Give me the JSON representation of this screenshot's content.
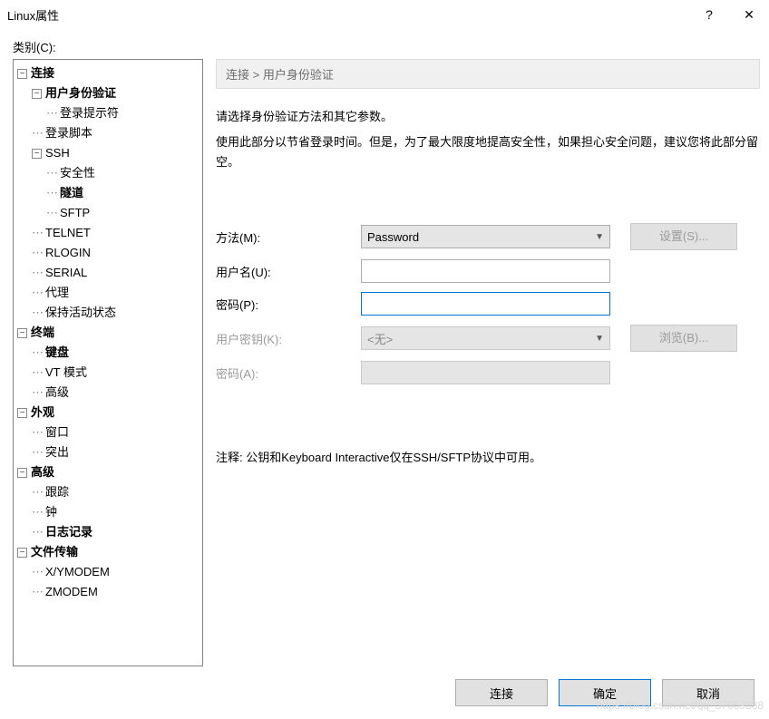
{
  "window": {
    "title": "Linux属性",
    "help": "?",
    "close": "✕"
  },
  "category_label": "类别(C):",
  "tree": {
    "connection": "连接",
    "user_auth": "用户身份验证",
    "login_prompt": "登录提示符",
    "login_script": "登录脚本",
    "ssh": "SSH",
    "security": "安全性",
    "tunnel": "隧道",
    "sftp": "SFTP",
    "telnet": "TELNET",
    "rlogin": "RLOGIN",
    "serial": "SERIAL",
    "proxy": "代理",
    "keep_alive": "保持活动状态",
    "terminal": "终端",
    "keyboard": "键盘",
    "vt_mode": "VT 模式",
    "advanced_term": "高级",
    "appearance": "外观",
    "window": "窗口",
    "highlight": "突出",
    "advanced": "高级",
    "tracking": "跟踪",
    "bell": "钟",
    "logging": "日志记录",
    "file_transfer": "文件传输",
    "xymodem": "X/YMODEM",
    "zmodem": "ZMODEM"
  },
  "breadcrumb": "连接 > 用户身份验证",
  "description": {
    "line1": "请选择身份验证方法和其它参数。",
    "line2": "使用此部分以节省登录时间。但是，为了最大限度地提高安全性，如果担心安全问题，建议您将此部分留空。"
  },
  "form": {
    "method_label": "方法(M):",
    "method_value": "Password",
    "settings_btn": "设置(S)...",
    "user_label": "用户名(U):",
    "user_value": "",
    "password_label": "密码(P):",
    "password_value": "",
    "userkey_label": "用户密钥(K):",
    "userkey_value": "<无>",
    "browse_btn": "浏览(B)...",
    "passphrase_label": "密码(A):"
  },
  "note": "注释: 公钥和Keyboard Interactive仅在SSH/SFTP协议中可用。",
  "footer": {
    "connect": "连接",
    "ok": "确定",
    "cancel": "取消"
  },
  "watermark": "https://blog.csdn.net/qq_37059838"
}
